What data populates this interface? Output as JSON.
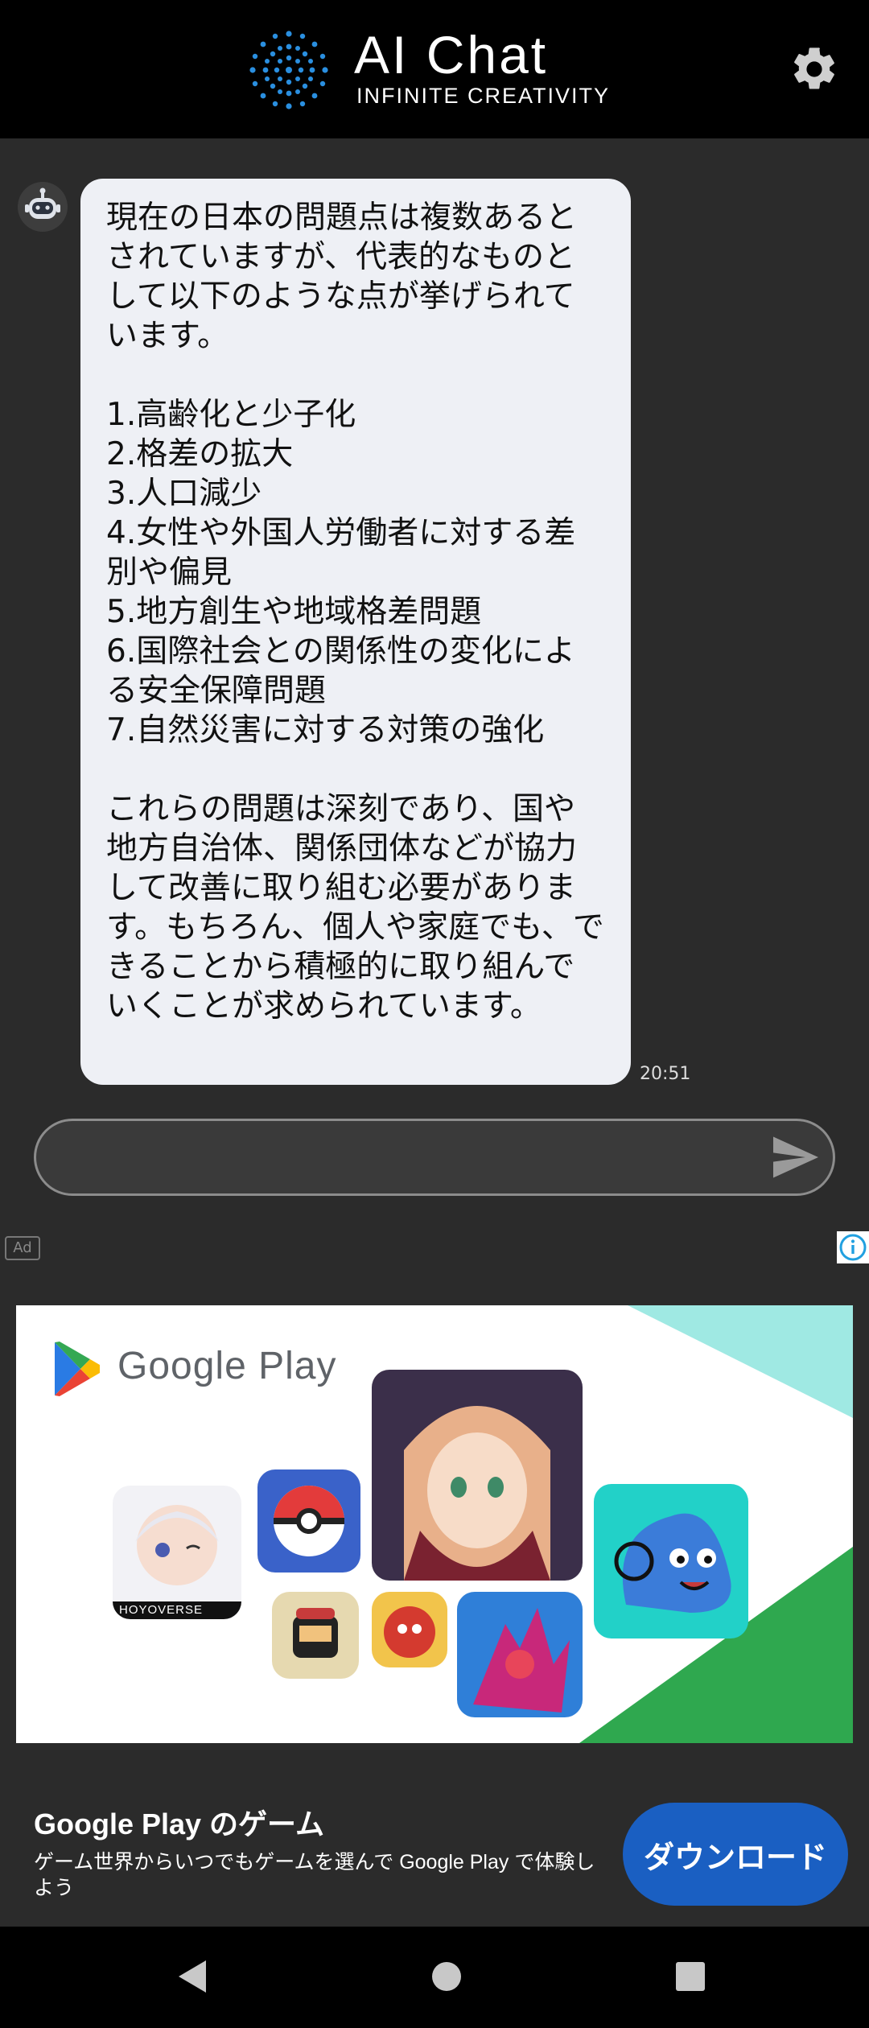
{
  "header": {
    "app_title": "AI Chat",
    "app_subtitle": "INFINITE CREATIVITY",
    "settings_icon": "gear-icon"
  },
  "chat": {
    "message": "現在の日本の問題点は複数あるとされていますが、代表的なものとして以下のような点が挙げられています。\n\n1.高齢化と少子化\n2.格差の拡大\n3.人口減少\n4.女性や外国人労働者に対する差別や偏見\n5.地方創生や地域格差問題\n6.国際社会との関係性の変化による安全保障問題\n7.自然災害に対する対策の強化\n\nこれらの問題は深刻であり、国や地方自治体、関係団体などが協力して改善に取り組む必要があります。もちろん、個人や家庭でも、できることから積極的に取り組んでいくことが求められています。",
    "timestamp": "20:51",
    "avatar_icon": "robot-icon"
  },
  "input": {
    "value": "",
    "placeholder": "",
    "send_icon": "send-icon"
  },
  "ad": {
    "badge": "Ad",
    "banner_brand": "Google Play",
    "title": "Google Play のゲーム",
    "description": "ゲーム世界からいつでもゲームを選んで Google Play で体験しよう",
    "button_label": "ダウンロード",
    "hoyoverse_label": "HOYOVERSE"
  },
  "colors": {
    "header_bg": "#000000",
    "body_bg": "#2b2b2b",
    "bubble_bg": "#eef0f5",
    "button_blue": "#1a5fc2"
  }
}
